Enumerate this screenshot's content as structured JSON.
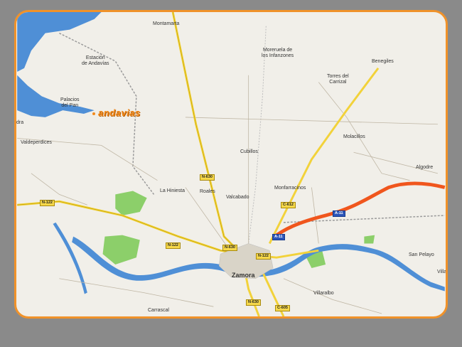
{
  "brand": {
    "name": "andavias",
    "color": "#f28a1c"
  },
  "colors": {
    "frame": "#f0922a",
    "water": "#4f8fd6",
    "park": "#8ccf6a",
    "road": "#f2d23a",
    "highway": "#f0561d",
    "background": "#f1efe9"
  },
  "places": {
    "montamarta": "Montamarta",
    "estacion": "Estación\nde Andavías",
    "palacios": "Palacios\ndel Pan",
    "moreruela": "Moreruela de\nlos Infanzones",
    "benegiles": "Benegiles",
    "torres": "Torres del\nCarrizal",
    "valdeperdices": "Valdeperdices",
    "molacillos": "Molacillos",
    "cubillos": "Cubillos",
    "algodre": "Algodre",
    "la_hiniesta": "La Hiniesta",
    "roales": "Roales",
    "valcabado": "Valcabado",
    "monfarracinos": "Monfarracinos",
    "zamora": "Zamora",
    "villaralbo": "Villaralbo",
    "san_pelayo": "San Pelayo",
    "carrascal": "Carrascal",
    "villalazan": "Villal",
    "edge_dra": "dra"
  },
  "roads": {
    "n630_north": "N-630",
    "n122_west": "N-122",
    "n122_center": "N-122",
    "n630_center": "N-630",
    "n122_east": "N-122",
    "c612": "C-612",
    "a11_east": "A-11",
    "a11_center": "A-11",
    "n630_south": "N-630",
    "c605": "C-605"
  }
}
